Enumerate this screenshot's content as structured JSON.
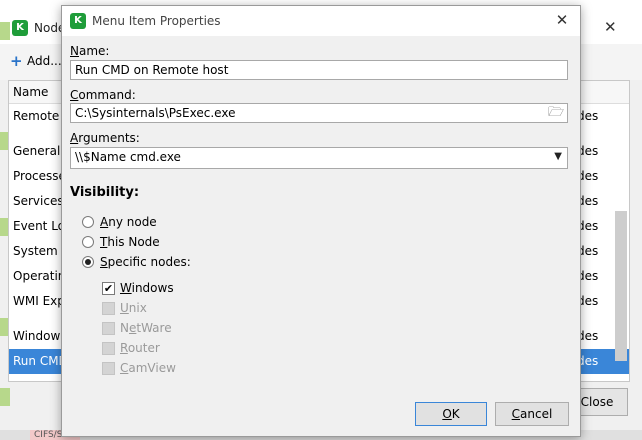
{
  "background_window": {
    "title": "Node",
    "add_label": "Add...",
    "column_name": "Name",
    "rows": [
      {
        "name": "Remote D",
        "nodes": "des"
      },
      {
        "name": "General I",
        "nodes": "des"
      },
      {
        "name": "Processes",
        "nodes": "des"
      },
      {
        "name": "Services",
        "nodes": "des"
      },
      {
        "name": "Event Log",
        "nodes": "des"
      },
      {
        "name": "System Ha",
        "nodes": "des"
      },
      {
        "name": "Operating",
        "nodes": "des"
      },
      {
        "name": "WMI Expl",
        "nodes": "des"
      },
      {
        "name": "Windows",
        "nodes": "des"
      },
      {
        "name": "Run CMD",
        "nodes": "des"
      }
    ],
    "close_label": "Close",
    "bottom_tag": "CIFS/SMB"
  },
  "dialog": {
    "title": "Menu Item Properties",
    "name_label_u": "N",
    "name_label_rest": "ame:",
    "name_value": "Run CMD on Remote host",
    "command_label_u": "C",
    "command_label_rest": "ommand:",
    "command_value": "C:\\Sysinternals\\PsExec.exe",
    "arguments_label_u": "A",
    "arguments_label_rest": "rguments:",
    "arguments_value": "\\\\$Name cmd.exe",
    "visibility_label": "Visibility:",
    "radios": [
      {
        "u": "A",
        "rest": "ny node",
        "selected": false
      },
      {
        "u": "T",
        "rest": "his Node",
        "selected": false
      },
      {
        "u": "S",
        "rest": "pecific nodes:",
        "selected": true
      }
    ],
    "checkboxes": [
      {
        "pre": "",
        "u": "W",
        "rest": "indows",
        "checked": true,
        "enabled": true
      },
      {
        "pre": "",
        "u": "U",
        "rest": "nix",
        "checked": false,
        "enabled": false
      },
      {
        "pre": "N",
        "u": "e",
        "rest": "tWare",
        "checked": false,
        "enabled": false
      },
      {
        "pre": "",
        "u": "R",
        "rest": "outer",
        "checked": false,
        "enabled": false
      },
      {
        "pre": "",
        "u": "C",
        "rest": "amView",
        "checked": false,
        "enabled": false
      }
    ],
    "ok_u": "O",
    "ok_rest": "K",
    "cancel_u": "C",
    "cancel_rest": "ancel"
  },
  "colors": {
    "accent": "#3a86d8",
    "logo": "#1f9d3a"
  },
  "icons": {
    "logo": "nmap-logo-icon",
    "browse": "folder-open-icon",
    "dropdown": "chevron-down-icon",
    "add": "plus-icon"
  }
}
